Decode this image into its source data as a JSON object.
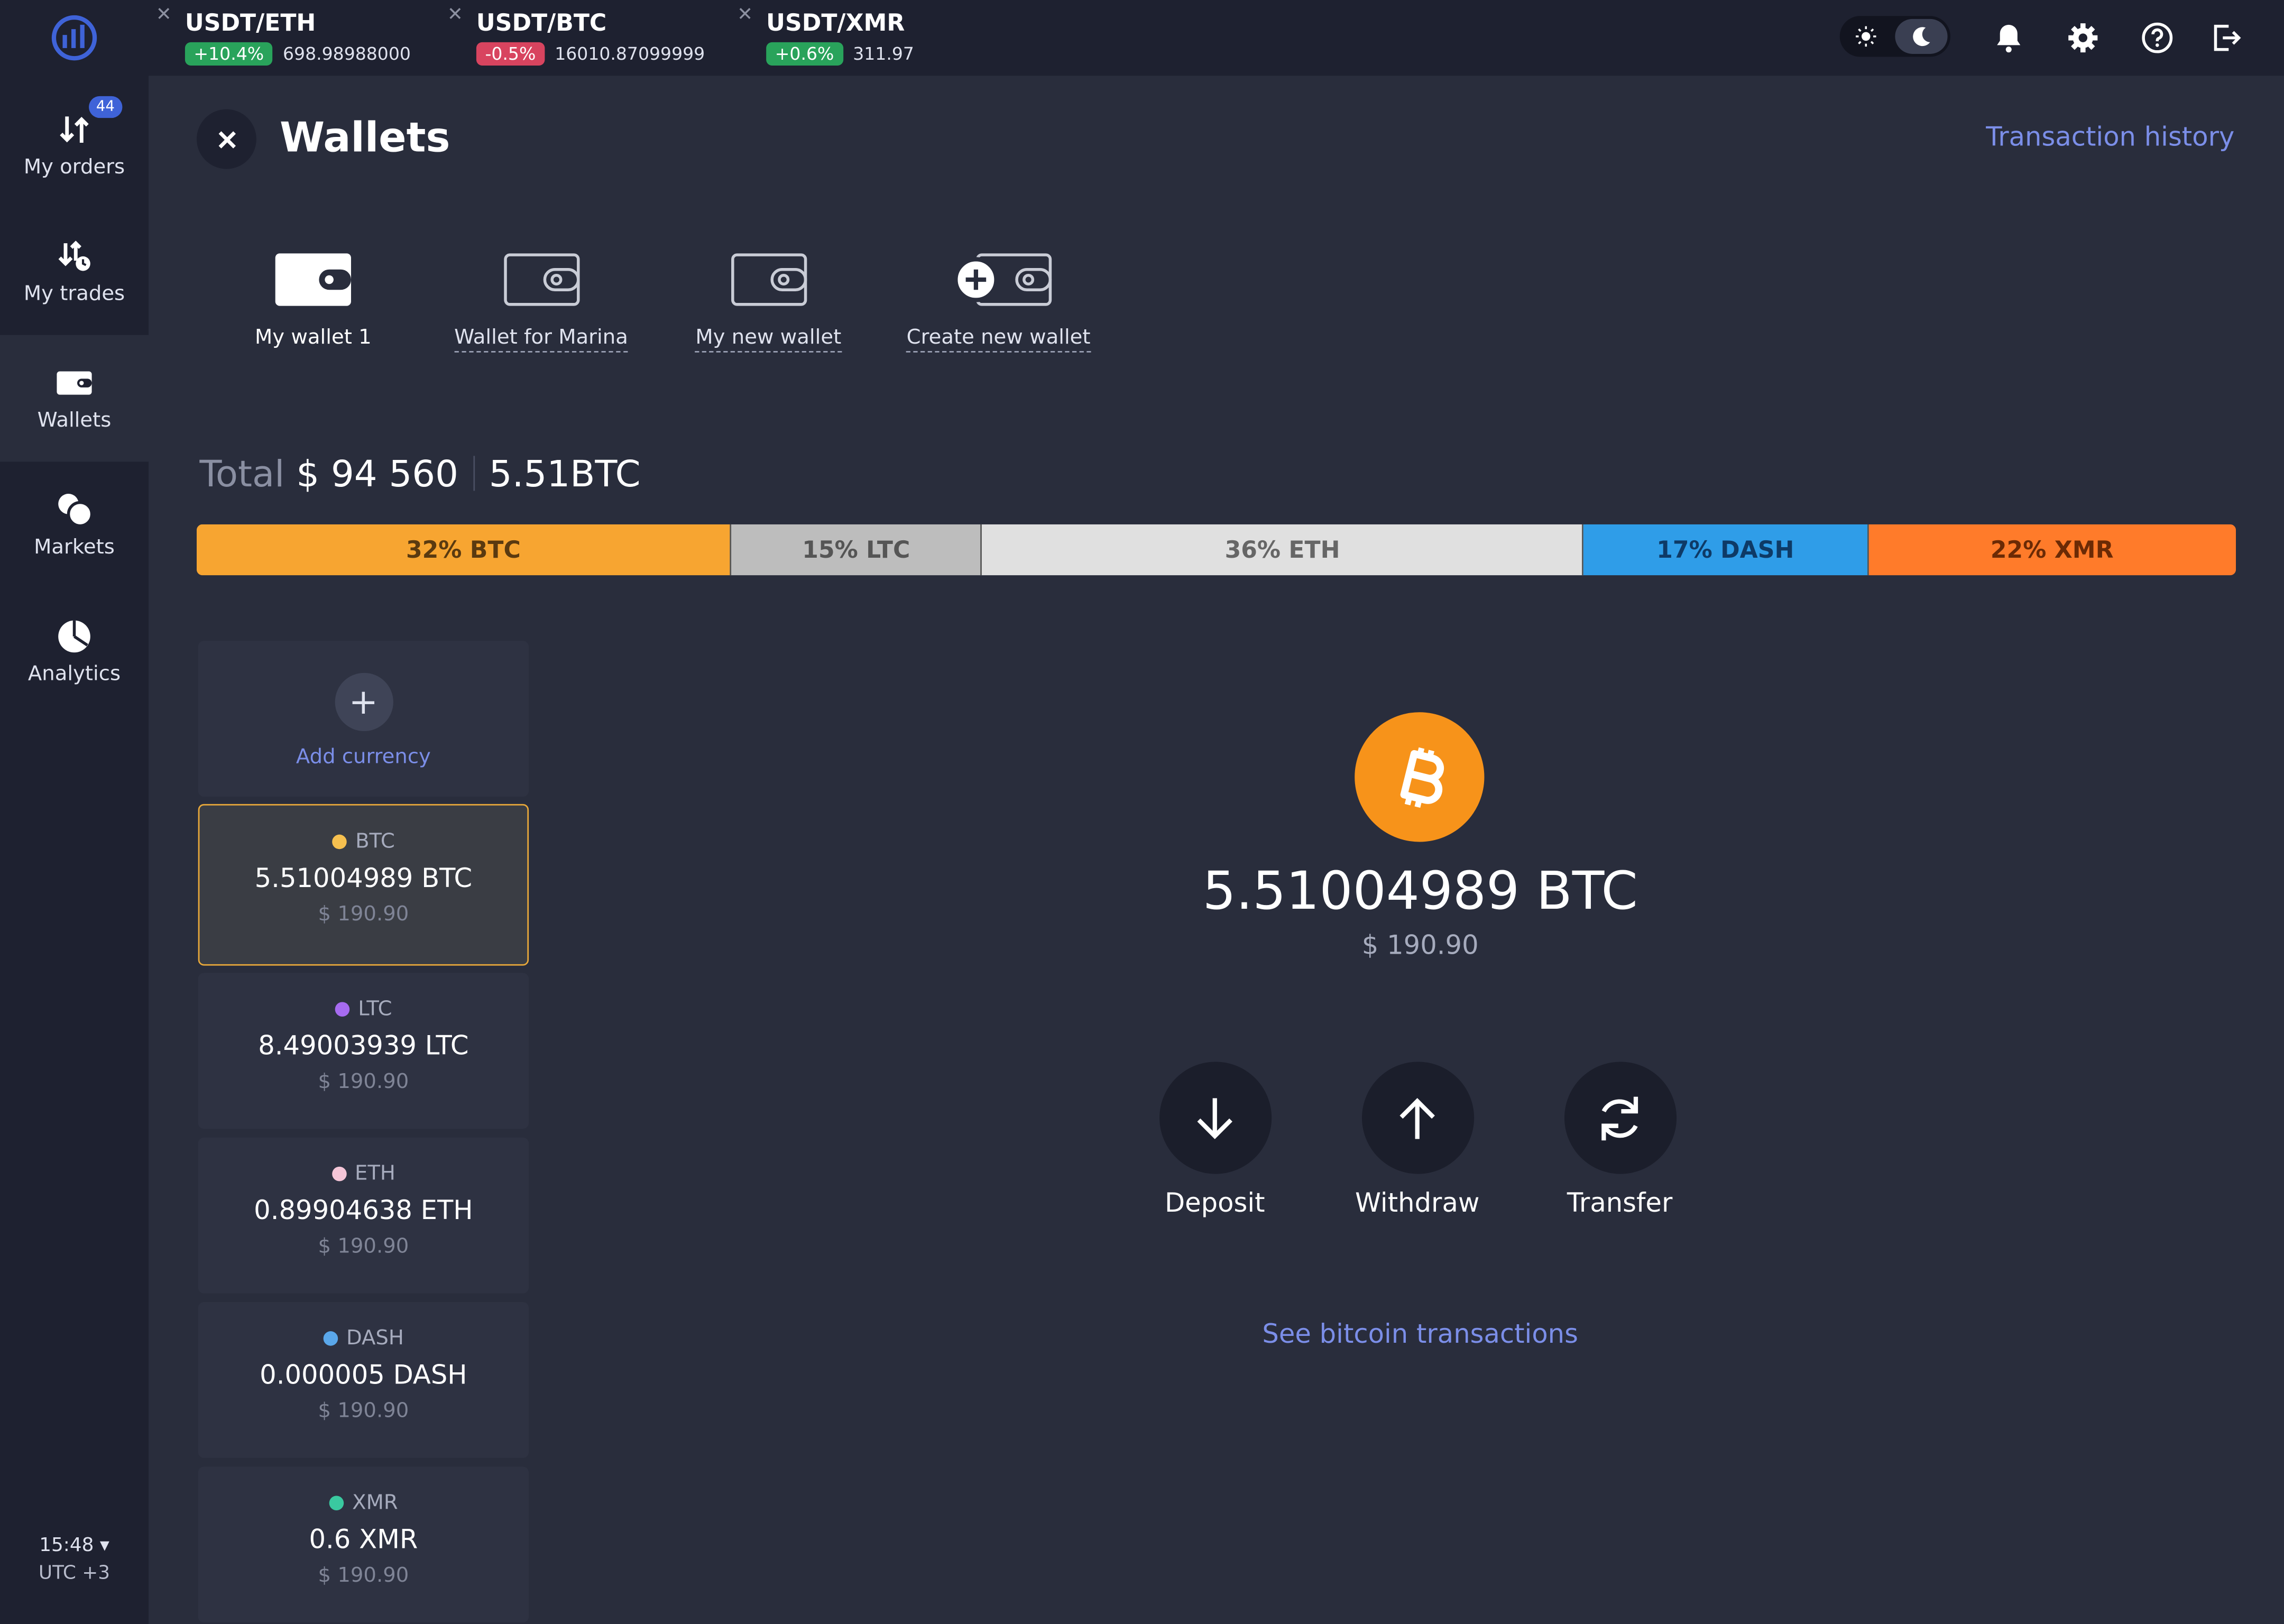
{
  "sidebar": {
    "items": [
      {
        "label": "My orders",
        "icon": "orders-arrows-icon",
        "badge": "44"
      },
      {
        "label": "My trades",
        "icon": "trades-clock-icon"
      },
      {
        "label": "Wallets",
        "icon": "wallet-icon"
      },
      {
        "label": "Markets",
        "icon": "markets-circles-icon"
      },
      {
        "label": "Analytics",
        "icon": "pie-chart-icon"
      }
    ],
    "time": "15:48 ▾",
    "timezone": "UTC +3"
  },
  "tickers": [
    {
      "pair": "USDT/ETH",
      "change": "+10.4%",
      "price": "698.98988000",
      "direction": "up"
    },
    {
      "pair": "USDT/BTC",
      "change": "-0.5%",
      "price": "16010.87099999",
      "direction": "down"
    },
    {
      "pair": "USDT/XMR",
      "change": "+0.6%",
      "price": "311.97",
      "direction": "up"
    }
  ],
  "header": {
    "title": "Wallets",
    "transaction_history": "Transaction history"
  },
  "wallets": [
    {
      "label": "My wallet 1",
      "active": true
    },
    {
      "label": "Wallet for Marina"
    },
    {
      "label": "My new wallet"
    },
    {
      "label": "Create new wallet"
    }
  ],
  "total": {
    "label": "Total",
    "usd": "$ 94 560",
    "btc": "5.51BTC"
  },
  "allocation": [
    {
      "label": "32% BTC",
      "percent": 32,
      "color": "#f7a531",
      "text_color": "#5a3a10"
    },
    {
      "label": "15% LTC",
      "percent": 15,
      "color": "#bdbdbd",
      "text_color": "#555555"
    },
    {
      "label": "36% ETH",
      "percent": 36,
      "color": "#e0e0e0",
      "text_color": "#666666"
    },
    {
      "label": "17% DASH",
      "percent": 17,
      "color": "#2f9de8",
      "text_color": "#0e3a66"
    },
    {
      "label": "22% XMR",
      "percent": 22,
      "color": "#ff7b2a",
      "text_color": "#6b2a05"
    }
  ],
  "add_currency": "Add currency",
  "currencies": [
    {
      "symbol": "BTC",
      "amount": "5.51004989 BTC",
      "usd": "$ 190.90",
      "dot": "#f6c04f",
      "active": true
    },
    {
      "symbol": "LTC",
      "amount": "8.49003939 LTC",
      "usd": "$ 190.90",
      "dot": "#a66bf0"
    },
    {
      "symbol": "ETH",
      "amount": "0.89904638 ETH",
      "usd": "$ 190.90",
      "dot": "#f5c6d8"
    },
    {
      "symbol": "DASH",
      "amount": "0.000005 DASH",
      "usd": "$ 190.90",
      "dot": "#5aa7ea"
    },
    {
      "symbol": "XMR",
      "amount": "0.6 XMR",
      "usd": "$ 190.90",
      "dot": "#3ac9a0"
    }
  ],
  "detail": {
    "icon": "bitcoin-icon",
    "amount": "5.51004989 BTC",
    "usd": "$ 190.90",
    "actions": [
      {
        "label": "Deposit",
        "icon": "arrow-down-icon"
      },
      {
        "label": "Withdraw",
        "icon": "arrow-up-icon"
      },
      {
        "label": "Transfer",
        "icon": "refresh-icon"
      }
    ],
    "see_transactions": "See bitcoin transactions"
  },
  "colors": {
    "background": "#292d3c",
    "sidebar": "#1e2130",
    "link": "#7b8ee8",
    "accent_active_border": "#e8a83a",
    "bitcoin": "#f7931a"
  }
}
